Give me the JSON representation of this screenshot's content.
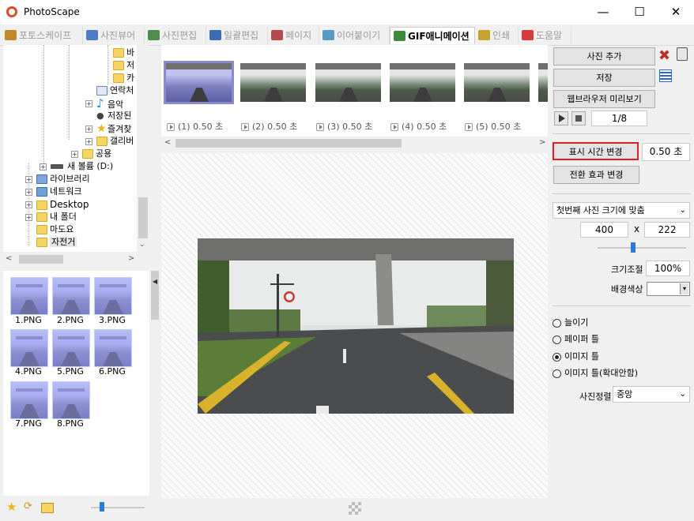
{
  "window": {
    "title": "PhotoScape",
    "controls": {
      "minimize": "—",
      "maximize": "☐",
      "close": "✕"
    }
  },
  "tabs": [
    {
      "label": "포토스케이프",
      "icon_color": "#c08a2a"
    },
    {
      "label": "사진뷰어",
      "icon_color": "#4e7bc4"
    },
    {
      "label": "사진편집",
      "icon_color": "#4f8c4f"
    },
    {
      "label": "일괄편집",
      "icon_color": "#3c6bb3"
    },
    {
      "label": "페이지",
      "icon_color": "#b44a4a"
    },
    {
      "label": "이어붙이기",
      "icon_color": "#5a9ac5"
    },
    {
      "label": "GIF애니메이션",
      "icon_color": "#3d8a3d"
    },
    {
      "label": "인쇄",
      "icon_color": "#c6a32e"
    },
    {
      "label": "도움말",
      "icon_color": "#d63a3a"
    }
  ],
  "tree": {
    "items": [
      "바",
      "저",
      "카",
      "연락처",
      "음악",
      "저장된",
      "즐겨찾",
      "갤리버",
      "공용",
      "새 볼륨 (D:)",
      "라이브러리",
      "네트워크",
      "Desktop",
      "내 폴더",
      "마도요",
      "자전거"
    ]
  },
  "thumbnails": [
    "1.PNG",
    "2.PNG",
    "3.PNG",
    "4.PNG",
    "5.PNG",
    "6.PNG",
    "7.PNG",
    "8.PNG"
  ],
  "filmstrip": [
    {
      "index": "(1)",
      "duration": "0.50",
      "unit": "초"
    },
    {
      "index": "(2)",
      "duration": "0.50",
      "unit": "초"
    },
    {
      "index": "(3)",
      "duration": "0.50",
      "unit": "초"
    },
    {
      "index": "(4)",
      "duration": "0.50",
      "unit": "초"
    },
    {
      "index": "(5)",
      "duration": "0.50",
      "unit": "초"
    }
  ],
  "right_panel": {
    "add_photo": "사진 추가",
    "save": "저장",
    "web_preview": "웹브라우저 미리보기",
    "frame_counter": "1/8",
    "change_display_time": "표시 시간 변경",
    "display_time_value": "0.50 초",
    "change_transition": "전환 효과 변경",
    "size_mode": "첫번째 사진 크기에 맞춤",
    "width": "400",
    "x_sep": "x",
    "height": "222",
    "scale_label": "크기조절",
    "scale_value": "100%",
    "bg_color_label": "배경색상",
    "radios": [
      {
        "label": "늘이기",
        "checked": false
      },
      {
        "label": "페이퍼 틀",
        "checked": false
      },
      {
        "label": "이미지 틀",
        "checked": true
      },
      {
        "label": "이미지 틀(확대안함)",
        "checked": false
      }
    ],
    "align_label": "사진정렬",
    "align_value": "중앙"
  },
  "colors": {
    "highlight_border": "#e02020",
    "accent_selection": "#8a8acd"
  }
}
